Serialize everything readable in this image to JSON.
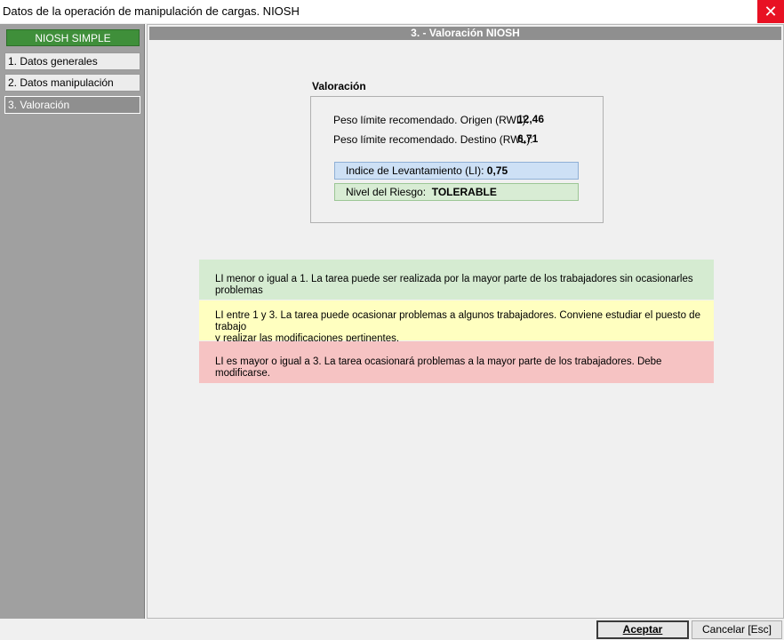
{
  "window": {
    "title": "Datos de la operación de manipulación de cargas. NIOSH",
    "close_glyph": "✕"
  },
  "sidebar": {
    "header": "NIOSH SIMPLE",
    "items": [
      {
        "label": "1. Datos generales"
      },
      {
        "label": "2. Datos manipulación"
      },
      {
        "label": "3. Valoración"
      }
    ]
  },
  "main": {
    "header": "3. - Valoración NIOSH",
    "valoracion": {
      "title": "Valoración",
      "rwl_origen_label": "Peso límite recomendado. Origen (RWL):",
      "rwl_origen_value": "12,46",
      "rwl_destino_label": "Peso límite recomendado. Destino (RWL):",
      "rwl_destino_value": "6,71",
      "li_label": "Indice de Levantamiento (LI):",
      "li_value": "0,75",
      "riesgo_label": "Nivel del Riesgo:",
      "riesgo_value": "TOLERABLE"
    },
    "legend": {
      "green_line1": "LI menor o igual a 1. La tarea puede ser realizada por la mayor parte de los trabajadores sin ocasionarles problemas",
      "yellow_line1": "LI entre 1 y 3. La tarea puede ocasionar problemas a algunos trabajadores. Conviene estudiar el puesto de trabajo",
      "yellow_line2": "y realizar las modificaciones pertinentes.",
      "red_line1": "LI es mayor o igual a 3. La tarea ocasionará problemas a la mayor parte de los trabajadores. Debe modificarse."
    }
  },
  "buttons": {
    "aceptar": "Aceptar",
    "cancelar": "Cancelar [Esc]"
  },
  "colors": {
    "accent_green": "#3f8f3a",
    "close_red": "#e81123",
    "li_blue": "#cde0f5",
    "risk_green": "#d8ecd4",
    "band_green": "#d5ebd1",
    "band_yellow": "#ffffc0",
    "band_red": "#f6c3c3"
  }
}
